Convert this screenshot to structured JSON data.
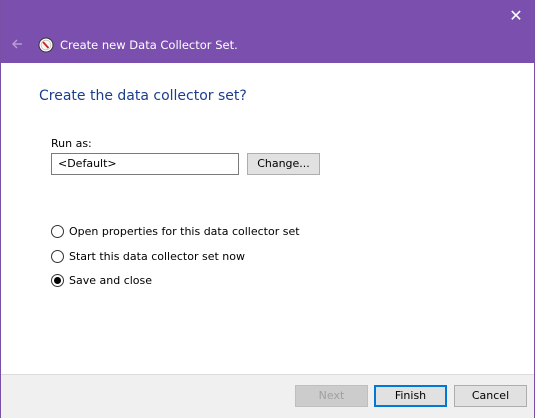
{
  "window": {
    "close_glyph": "✕",
    "wizard_title": "Create new Data Collector Set.",
    "accent_color": "#7b4fad"
  },
  "page": {
    "heading": "Create the data collector set?"
  },
  "run_as": {
    "label": "Run as:",
    "value": "<Default>",
    "change_label": "Change..."
  },
  "options": [
    {
      "label": "Open properties for this data collector set",
      "checked": false
    },
    {
      "label": "Start this data collector set now",
      "checked": false
    },
    {
      "label": "Save and close",
      "checked": true
    }
  ],
  "footer": {
    "next_label": "Next",
    "finish_label": "Finish",
    "cancel_label": "Cancel"
  }
}
